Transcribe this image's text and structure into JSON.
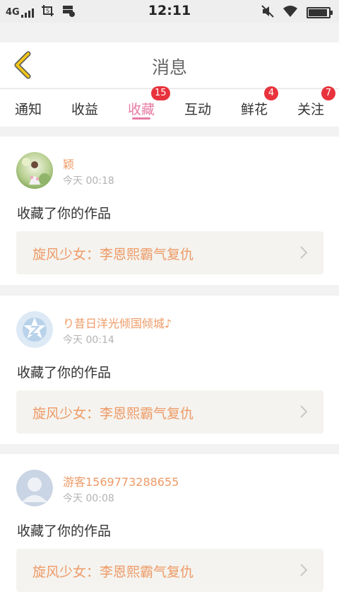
{
  "status_bar": {
    "network": "4G",
    "time": "12:11",
    "icons": [
      "signal-icon",
      "screenshot-icon",
      "storage-icon",
      "mute-icon",
      "wifi-icon",
      "battery-icon"
    ]
  },
  "header": {
    "title": "消息",
    "back_icon": "chevron-left-icon"
  },
  "tabs": [
    {
      "label": "通知",
      "badge": ""
    },
    {
      "label": "收益",
      "badge": ""
    },
    {
      "label": "收藏",
      "badge": "15",
      "active": true
    },
    {
      "label": "互动",
      "badge": ""
    },
    {
      "label": "鲜花",
      "badge": "4"
    },
    {
      "label": "关注",
      "badge": "7"
    }
  ],
  "messages": [
    {
      "username": "颖",
      "time": "今天 00:18",
      "action": "收藏了你的作品",
      "work_title": "旋风少女：李恩熙霸气复仇",
      "avatar": "photo-avatar"
    },
    {
      "username": "り昔日洋光倾国倾城♪",
      "time": "今天 00:14",
      "action": "收藏了你的作品",
      "work_title": "旋风少女：李恩熙霸气复仇",
      "avatar": "star-avatar"
    },
    {
      "username": "游客1569773288655",
      "time": "今天 00:08",
      "action": "收藏了你的作品",
      "work_title": "旋风少女：李恩熙霸气复仇",
      "avatar": "default-avatar"
    }
  ],
  "colors": {
    "accent_pink": "#e87aa4",
    "username_orange": "#ee9a66",
    "badge_red": "#e8323c",
    "back_yellow": "#f0c419"
  }
}
